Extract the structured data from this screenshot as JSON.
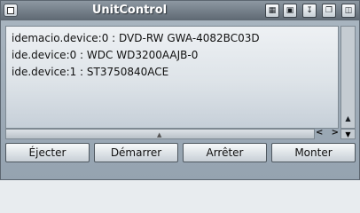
{
  "window": {
    "title": "UnitControl"
  },
  "titlebar_buttons": [
    "iconify-icon",
    "snapshot-icon",
    "jump-icon",
    "depth-icon",
    "zoom-icon"
  ],
  "devices": [
    "idemacio.device:0 : DVD-RW GWA-4082BC03D",
    "ide.device:0 : WDC WD3200AAJB-0",
    "ide.device:1 : ST3750840ACE"
  ],
  "actions": {
    "eject": "Éjecter",
    "start": "Démarrer",
    "stop": "Arrêter",
    "mount": "Monter"
  }
}
